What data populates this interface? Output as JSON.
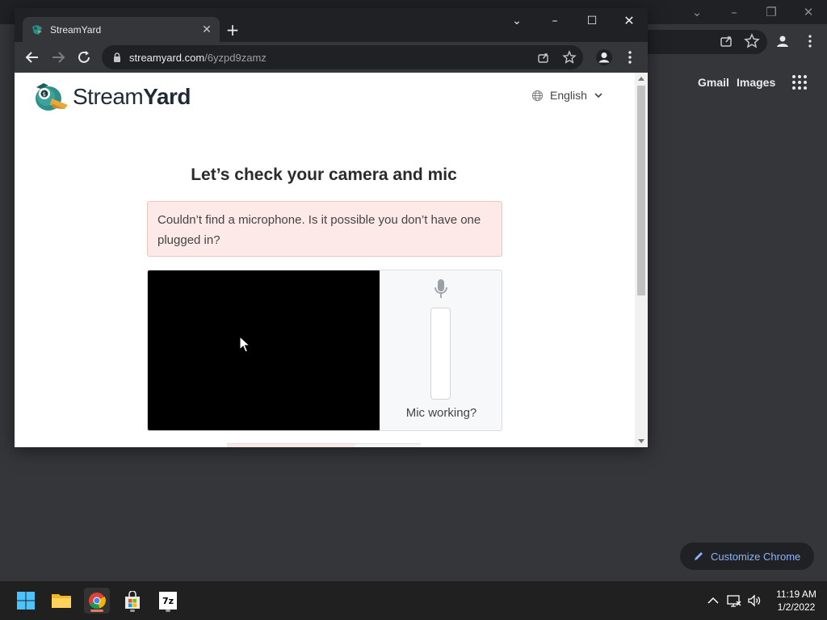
{
  "background_window": {
    "links": [
      "Gmail",
      "Images"
    ],
    "customize_label": "Customize Chrome"
  },
  "window": {
    "tab_title": "StreamYard",
    "url_host": "streamyard.com",
    "url_path": "/6yzpd9zamz"
  },
  "page": {
    "brand_regular": "Stream",
    "brand_bold": "Yard",
    "language": "English",
    "heading": "Let’s check your camera and mic",
    "alert_text": "Couldn’t find a microphone. Is it possible you don’t have one plugged in?",
    "mic_label": "Mic working?"
  },
  "taskbar": {
    "apps": [
      "start-icon",
      "file-explorer-icon",
      "chrome-icon",
      "store-icon",
      "7zip-icon"
    ],
    "sevenzip_label": "7z",
    "time": "11:19 AM",
    "date": "1/2/2022"
  },
  "colors": {
    "alert_bg": "#fde9e7",
    "link_blue": "#8ab4f8",
    "taskbar": "#202020"
  }
}
